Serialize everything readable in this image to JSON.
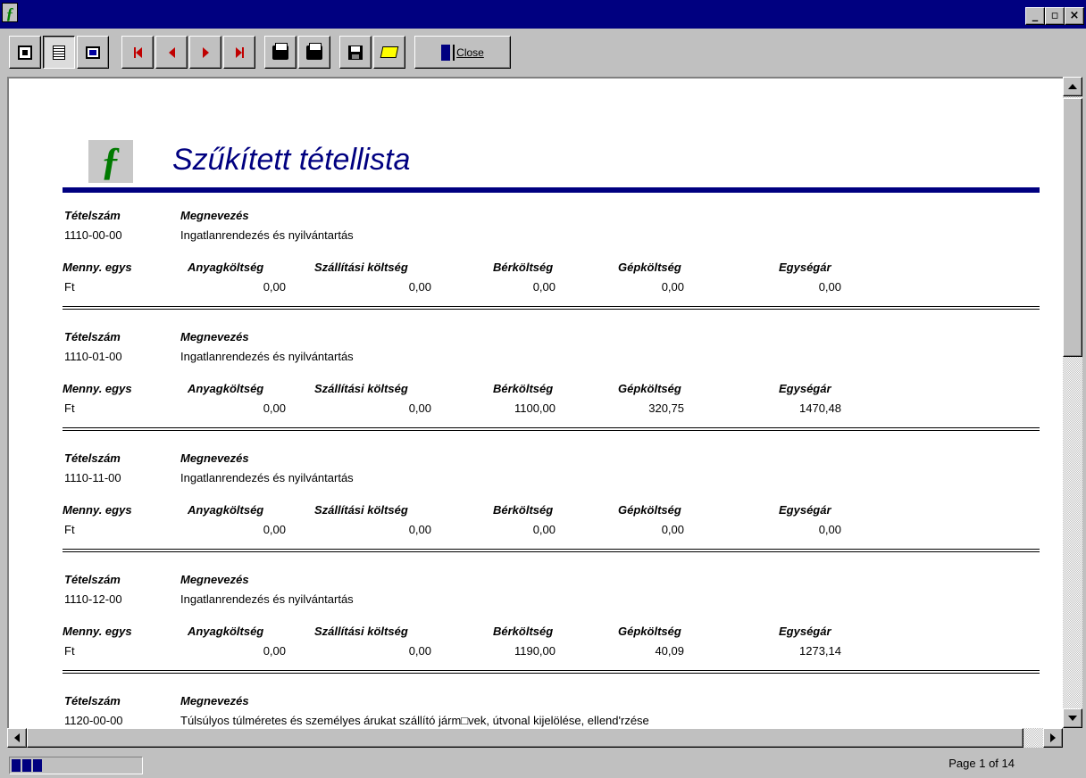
{
  "window": {
    "icon": "ƒ",
    "minimize": "_",
    "maximize": "▫",
    "close": "×"
  },
  "toolbar": {
    "close_label": "Close"
  },
  "report": {
    "title": "Szűkített tétellista",
    "logo": "ƒ",
    "headers": {
      "item_no": "Tételszám",
      "name": "Megnevezés",
      "unit": "Menny. egys",
      "material": "Anyagköltség",
      "transport": "Szállítási költség",
      "labor": "Bérköltség",
      "machine": "Gépköltség",
      "unit_price": "Egységár"
    },
    "records": [
      {
        "item_no": "1110-00-00",
        "name": "Ingatlanrendezés és nyilvántartás",
        "unit": "Ft",
        "material": "0,00",
        "transport": "0,00",
        "labor": "0,00",
        "machine": "0,00",
        "unit_price": "0,00"
      },
      {
        "item_no": "1110-01-00",
        "name": "Ingatlanrendezés és nyilvántartás",
        "unit": "Ft",
        "material": "0,00",
        "transport": "0,00",
        "labor": "1100,00",
        "machine": "320,75",
        "unit_price": "1470,48"
      },
      {
        "item_no": "1110-11-00",
        "name": "Ingatlanrendezés és nyilvántartás",
        "unit": "Ft",
        "material": "0,00",
        "transport": "0,00",
        "labor": "0,00",
        "machine": "0,00",
        "unit_price": "0,00"
      },
      {
        "item_no": "1110-12-00",
        "name": "Ingatlanrendezés és nyilvántartás",
        "unit": "Ft",
        "material": "0,00",
        "transport": "0,00",
        "labor": "1190,00",
        "machine": "40,09",
        "unit_price": "1273,14"
      },
      {
        "item_no": "1120-00-00",
        "name": "Túlsúlyos túlméretes és személyes árukat szállító járm□vek, útvonal kijelölése, ellend'rzése"
      }
    ]
  },
  "status": {
    "page_info": "Page 1 of 14",
    "progress_blocks": 3
  }
}
